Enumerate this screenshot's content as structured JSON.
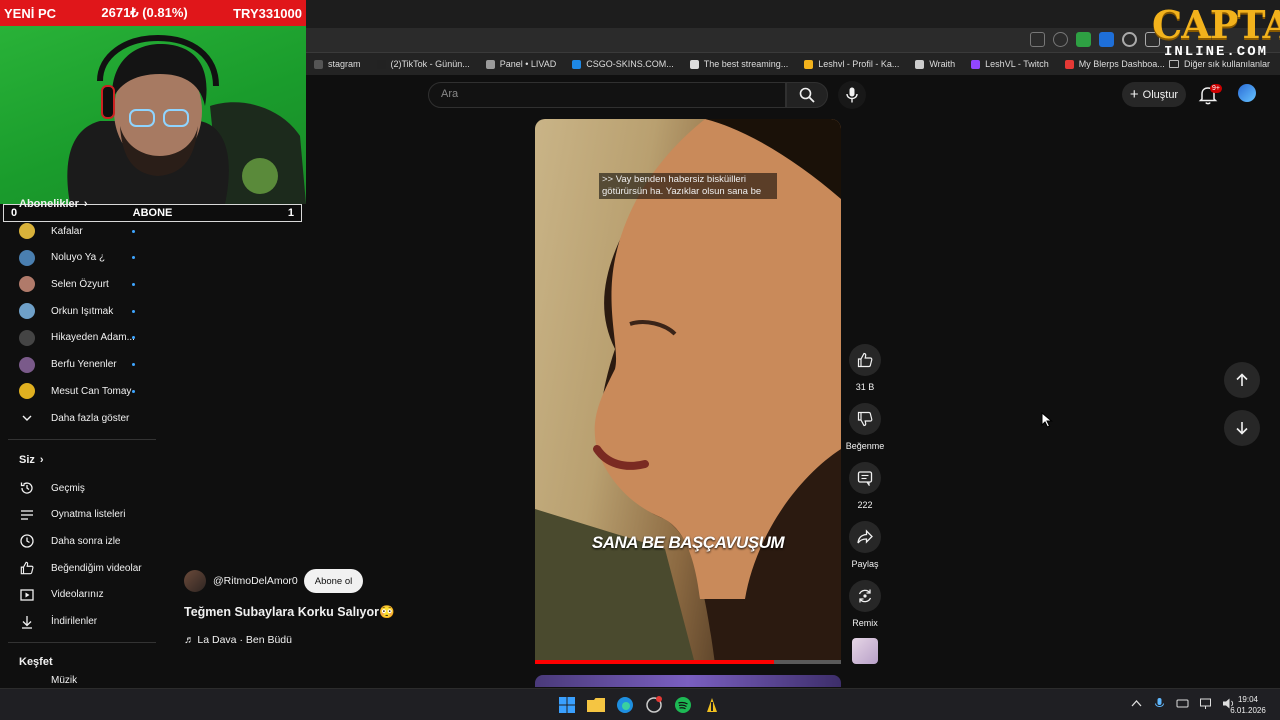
{
  "overlay": {
    "ticker_left": "YENİ PC",
    "ticker_mid": "2671₺ (0.81%)",
    "ticker_right": "TRY331000",
    "abone_left": "0",
    "abone_label": "ABONE",
    "abone_right": "1"
  },
  "logo": {
    "line1": "CAPTAN",
    "line2": "INLINE.COM"
  },
  "bookmarks": {
    "items": [
      "stagram",
      "(2)TikTok - Günün...",
      "Panel • LIVAD",
      "CSGO-SKINS.COM...",
      "The best streaming...",
      "Leshvl - Profil - Ka...",
      "Wraith",
      "LeshVL - Twitch",
      "My Blerps Dashboa..."
    ],
    "icon_colors": [
      "#555555",
      "#222222",
      "#9b9b9b",
      "#1e88e5",
      "#dddddd",
      "#f2b21c",
      "#cccccc",
      "#9146ff",
      "#e53935"
    ],
    "others_label": "Diğer sık kullanılanlar"
  },
  "header": {
    "search_placeholder": "Ara",
    "create_label": "Oluştur",
    "notif_badge": "9+"
  },
  "sidebar": {
    "subs_title": "Abonelikler",
    "subs": [
      {
        "label": "Kafalar",
        "color": "#d9b23a"
      },
      {
        "label": "Noluyo Ya ¿",
        "color": "#4a7fb0"
      },
      {
        "label": "Selen Özyurt",
        "color": "#b07a6a"
      },
      {
        "label": "Orkun Işıtmak",
        "color": "#6fa0c8"
      },
      {
        "label": "Hikayeden Adam...",
        "color": "#444444"
      },
      {
        "label": "Berfu Yenenler",
        "color": "#7a5a8a"
      },
      {
        "label": "Mesut Can Tomay",
        "color": "#e0b020"
      }
    ],
    "show_more": "Daha fazla göster",
    "you_title": "Siz",
    "you_items": [
      {
        "label": "Geçmiş",
        "icon": "history-icon"
      },
      {
        "label": "Oynatma listeleri",
        "icon": "playlist-icon"
      },
      {
        "label": "Daha sonra izle",
        "icon": "clock-icon"
      },
      {
        "label": "Beğendiğim videolar",
        "icon": "thumbs-up-icon"
      },
      {
        "label": "Videolarınız",
        "icon": "video-icon"
      },
      {
        "label": "İndirilenler",
        "icon": "download-icon"
      }
    ],
    "explore_title": "Keşfet",
    "explore_partial": "Müzik"
  },
  "short": {
    "caption": ">> Vay benden habersiz bisküilleri götürürsün ha. Yazıklar olsun sana be",
    "overlay_text": "SANA BE BAŞÇAVUŞUM",
    "progress": 0.78,
    "channel": "@RitmoDelAmor0",
    "subscribe_label": "Abone ol",
    "title": "Teğmen Subaylara Korku Salıyor😳",
    "sound": "♬ La Dava · Ben Büdü"
  },
  "actions": {
    "like_count": "31 B",
    "dislike_label": "Beğenme",
    "comment_count": "222",
    "share_label": "Paylaş",
    "remix_label": "Remix"
  },
  "taskbar": {
    "time": "19:04",
    "date": "6.01.2026"
  }
}
